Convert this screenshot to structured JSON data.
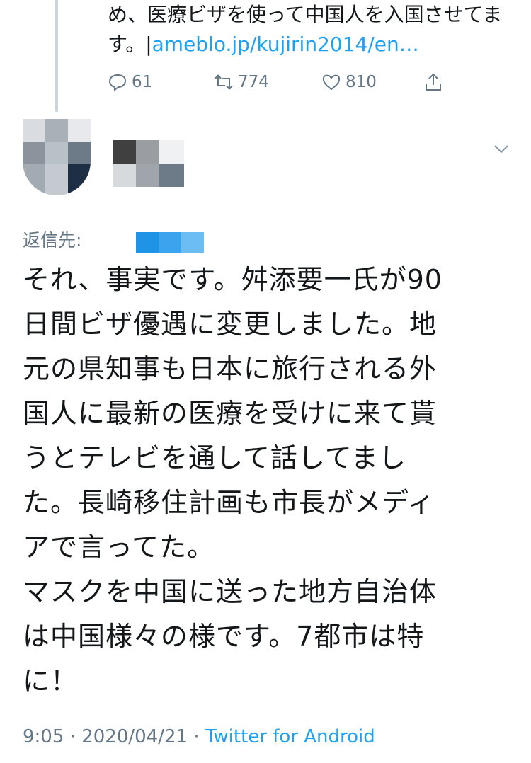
{
  "previous_tweet": {
    "text_lines": [
      "め、医療ビザを使って中国人を入国させてま",
      "す。"
    ],
    "link": "ameblo.jp/kujirin2014/en…",
    "stats": {
      "replies": "61",
      "retweets": "774",
      "likes": "810"
    }
  },
  "tweet": {
    "replying_to_label": "返信先:",
    "body_lines": [
      "それ、事実です。舛添要一氏が90",
      "日間ビザ優遇に変更しました。地",
      "元の県知事も日本に旅行される外",
      "国人に最新の医療を受けに来て貰",
      "うとテレビを通して話してまし",
      "た。長崎移住計画も市長がメディ",
      "アで言ってた。",
      "マスクを中国に送った地方自治体",
      "は中国様々の様です。7都市は特",
      "に！"
    ],
    "time": "9:05",
    "separator": "·",
    "date": "2020/04/21",
    "source": "Twitter for Android"
  },
  "colors": {
    "accent": "#1da1f2",
    "secondary_text": "#657786",
    "text": "#14171a",
    "thread_line": "#ccd6dd"
  },
  "icons": {
    "reply": "comment-bubble-icon",
    "retweet": "retweet-icon",
    "like": "heart-icon",
    "share": "share-upload-icon",
    "menu": "chevron-down-icon"
  }
}
